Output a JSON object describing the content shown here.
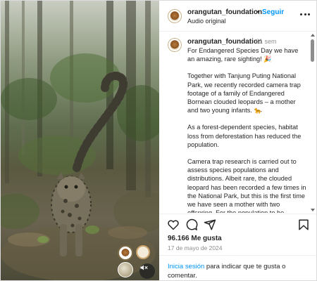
{
  "header": {
    "username": "orangutan_foundation",
    "separator": "•",
    "follow_label": "Seguir",
    "audio_label": "Audio original",
    "more_icon": "more-horizontal-icon"
  },
  "caption": {
    "username": "orangutan_foundation",
    "time_ago": "61 sem",
    "paragraphs": [
      "For Endangered Species Day we have an amazing, rare sighting! 🎉",
      "Together with Tanjung Puting National Park, we recently recorded camera trap footage of a family of Endangered Bornean clouded leopards – a mother and two young infants. 🐆",
      "As a forest-dependent species, habitat loss from deforestation has reduced the population.",
      "Camera trap research is carried out to assess species populations and distributions. Albeit rare, the clouded leopard has been recorded a few times in the National Park, but this is the first time we have seen a mother with two offspring. For the population to be"
    ]
  },
  "actions": {
    "like_icon": "heart-icon",
    "comment_icon": "comment-icon",
    "share_icon": "share-icon",
    "save_icon": "bookmark-icon"
  },
  "likes": "96.166 Me gusta",
  "date": "17 de mayo de 2024",
  "footer": {
    "login_link": "Inicia sesión",
    "login_rest": " para indicar que te gusta o comentar."
  },
  "colors": {
    "accent": "#0095f6",
    "text": "#262626",
    "muted": "#8e8e8e"
  },
  "media": {
    "mute_icon": "volume-muted-icon"
  }
}
